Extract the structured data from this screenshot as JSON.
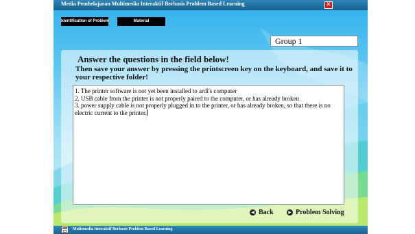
{
  "window": {
    "title": "Media Pembelajaran Multimedia Interaktif Berbasis Problem Based Learning",
    "close_glyph": "✕"
  },
  "tabs": [
    {
      "label": "Identification of Problem"
    },
    {
      "label": "Material"
    }
  ],
  "group": {
    "value": "Group 1"
  },
  "instructions": {
    "line1": "Answer the questions in the field below!",
    "line2": "Then save your answer by pressing the printscreen key on the keyboard, and save it to your respective folder!"
  },
  "answer": {
    "lines": [
      "1. The printer software is not yet been installed to ardi's computer",
      "2. USB cable from the printer is not properly paired to the computer, or has already broken",
      "3. power supply cable is not properly plugged in to the printer, or has already broken, so that there is no electric current to the printer."
    ]
  },
  "navigation": {
    "back_label": "Back",
    "problem_solving_label": "Problem Solving",
    "back_icon": "◀",
    "forward_icon": "▶"
  },
  "footer": {
    "text": "Multimedia Interaktif Berbasis Problem Based Learning",
    "icon": "printer-icon"
  },
  "colors": {
    "titlebar": "#1a5f8e",
    "close_button": "#d01f1f",
    "tab_background": "#000000",
    "stage_top": "#2fb1ec",
    "stage_bottom": "#c9efe0"
  }
}
